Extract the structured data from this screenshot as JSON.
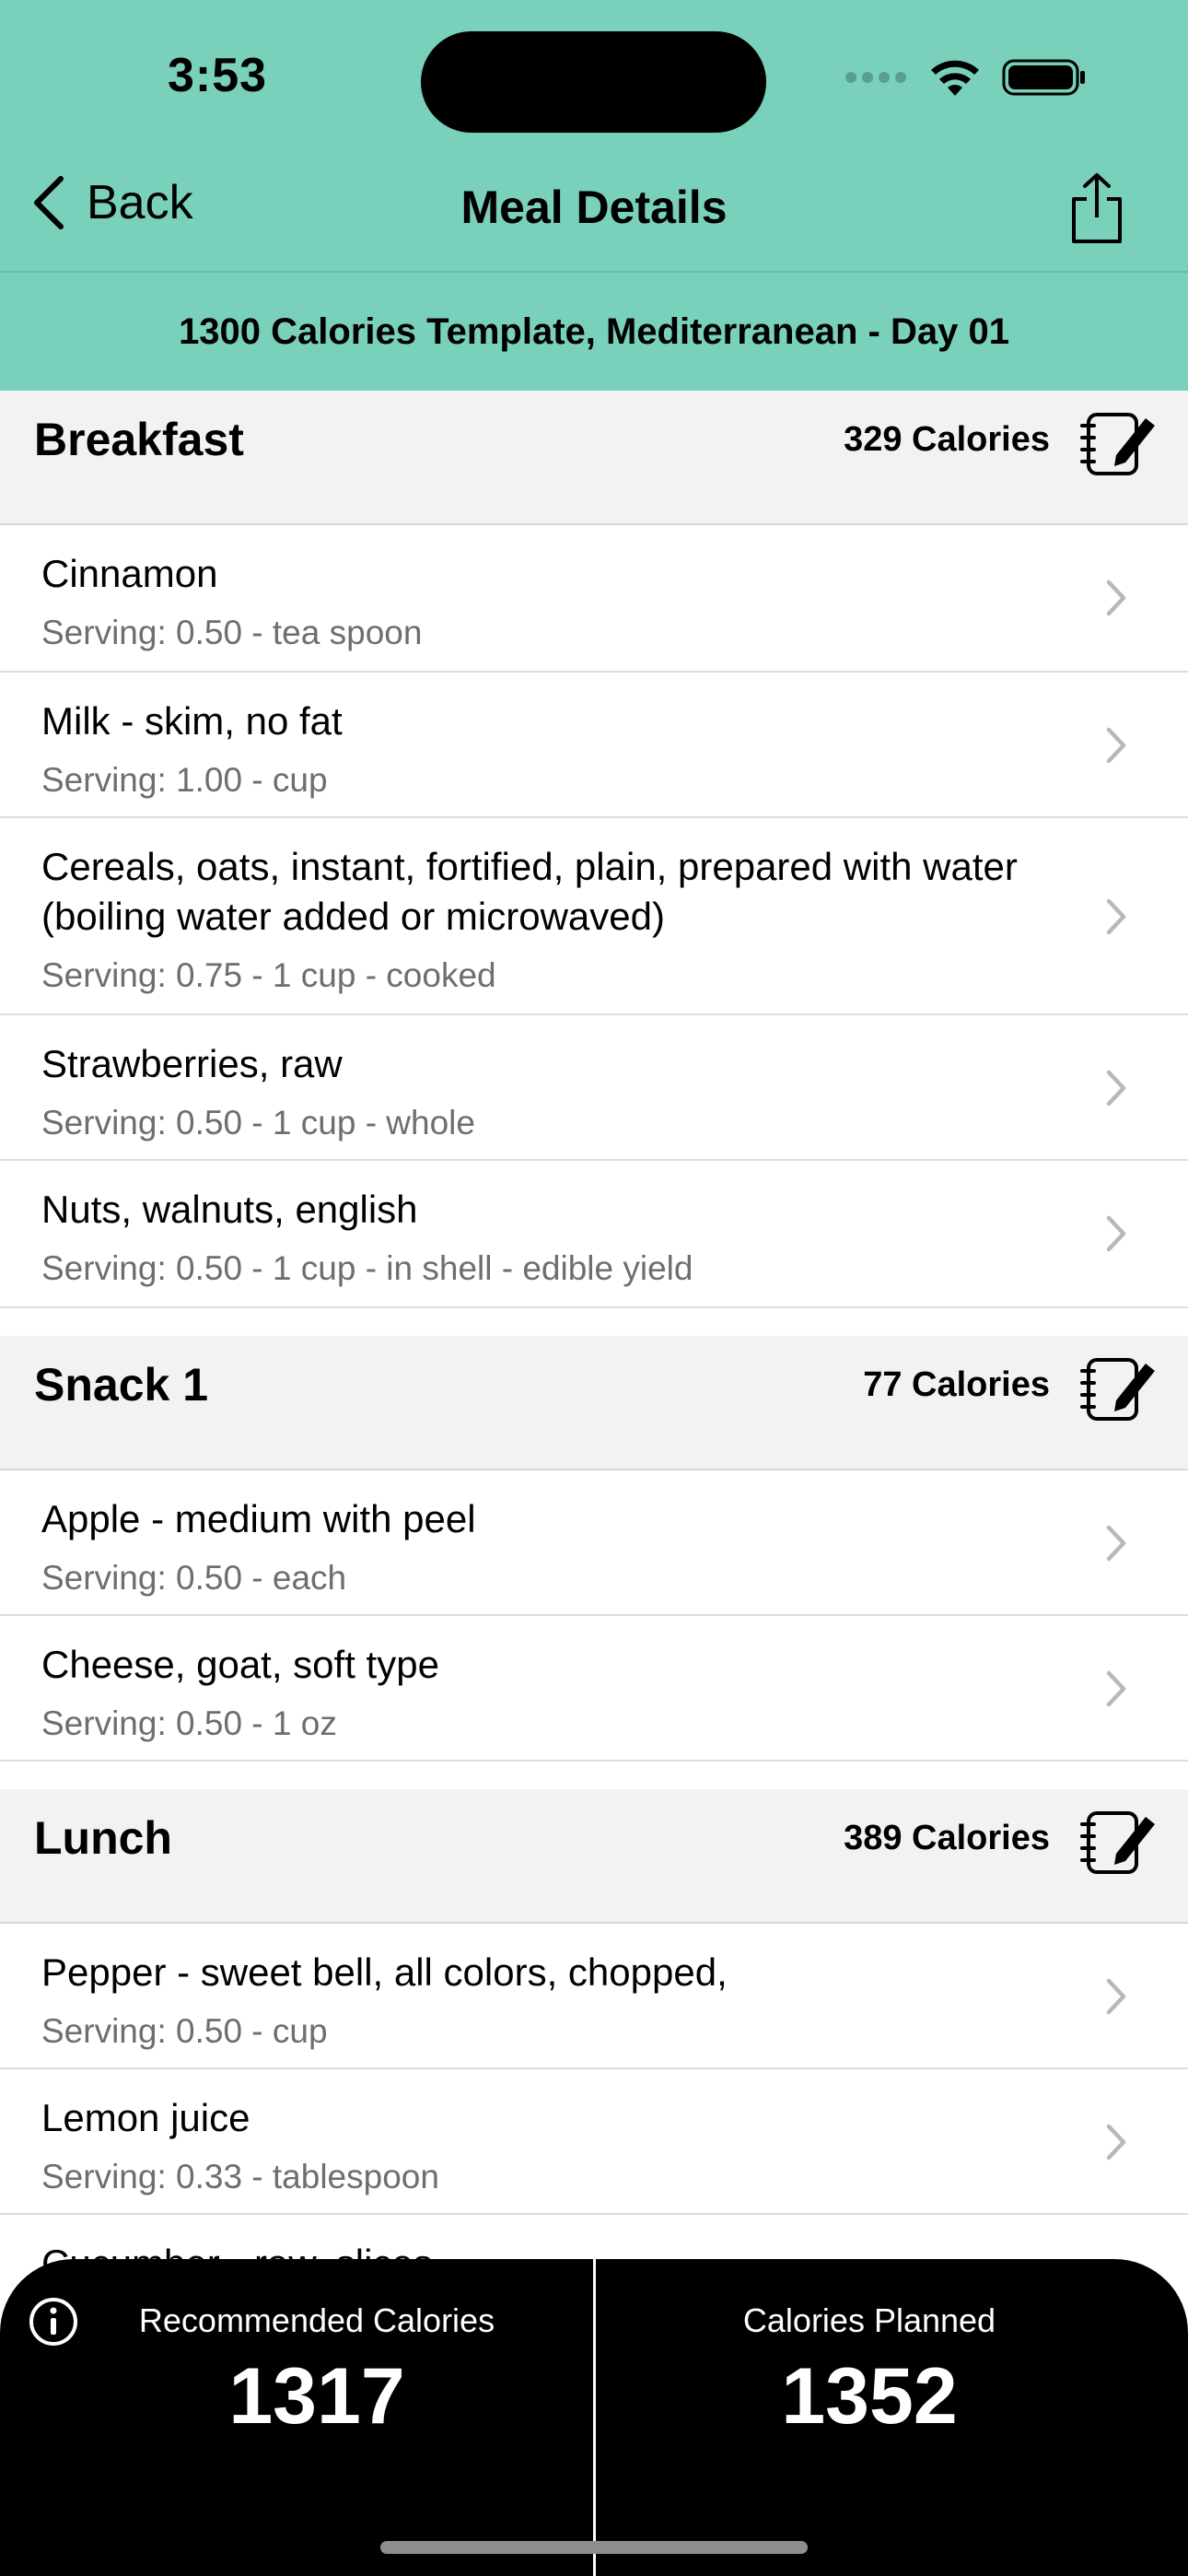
{
  "status": {
    "time": "3:53"
  },
  "nav": {
    "back_label": "Back",
    "title": "Meal Details"
  },
  "plan_title": "1300 Calories Template, Mediterranean - Day 01",
  "sections": [
    {
      "name": "Breakfast",
      "calories": "329 Calories",
      "items": [
        {
          "name": "Cinnamon",
          "serving": "Serving: 0.50 - tea spoon"
        },
        {
          "name": "Milk - skim, no fat",
          "serving": "Serving: 1.00 - cup"
        },
        {
          "name": "Cereals, oats, instant, fortified, plain, prepared with water (boiling water added or microwaved)",
          "serving": "Serving: 0.75 - 1 cup -  cooked"
        },
        {
          "name": "Strawberries, raw",
          "serving": "Serving: 0.50 - 1 cup -  whole"
        },
        {
          "name": "Nuts, walnuts, english",
          "serving": "Serving: 0.50 - 1 cup -  in shell -  edible yield"
        }
      ]
    },
    {
      "name": "Snack 1",
      "calories": "77 Calories",
      "items": [
        {
          "name": "Apple - medium with peel",
          "serving": "Serving: 0.50 - each"
        },
        {
          "name": "Cheese, goat, soft type",
          "serving": "Serving: 0.50 - 1 oz"
        }
      ]
    },
    {
      "name": "Lunch",
      "calories": "389 Calories",
      "items": [
        {
          "name": "Pepper - sweet bell, all colors, chopped,",
          "serving": "Serving: 0.50 - cup"
        },
        {
          "name": "Lemon juice",
          "serving": "Serving: 0.33 - tablespoon"
        },
        {
          "name": "Cucumber - raw, slices"
        }
      ]
    }
  ],
  "summary": {
    "recommended_label": "Recommended Calories",
    "recommended_value": "1317",
    "planned_label": "Calories Planned",
    "planned_value": "1352"
  },
  "icons": {
    "back": "chevron-left-icon",
    "share": "share-icon",
    "edit": "notepad-edit-icon",
    "row": "chevron-right-icon",
    "info": "info-icon"
  },
  "colors": {
    "header_bg": "#79d0bb",
    "section_bg": "#f2f2f2",
    "summary_bg": "#000000"
  }
}
